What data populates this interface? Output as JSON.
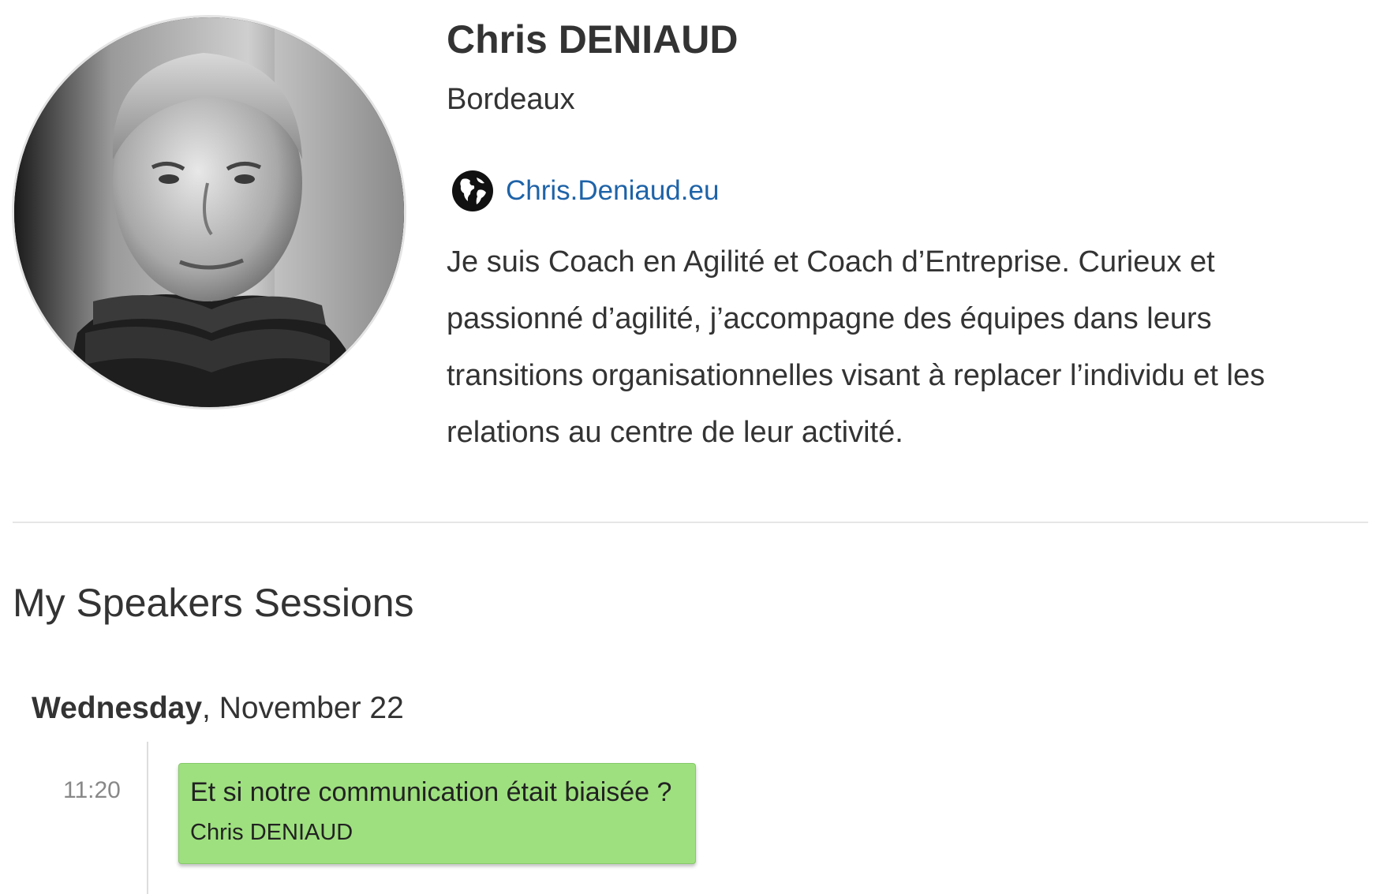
{
  "speaker": {
    "name": "Chris DENIAUD",
    "city": "Bordeaux",
    "website": "Chris.Deniaud.eu",
    "website_icon": "globe-icon",
    "bio": "Je suis Coach en Agilité et Coach d’Entreprise. Curieux et passionné d’agilité, j’accompagne des équipes dans leurs transitions organisationnelles visant à replacer l’individu et les relations au centre de leur activité.",
    "avatar": "speaker-photo"
  },
  "sessions": {
    "heading": "My Speakers Sessions",
    "day": {
      "weekday": "Wednesday",
      "rest": ", November 22"
    },
    "items": [
      {
        "time": "11:20",
        "title": "Et si notre communication était biaisée ?",
        "speaker": "Chris DENIAUD",
        "color": "#9ee07f"
      }
    ]
  }
}
